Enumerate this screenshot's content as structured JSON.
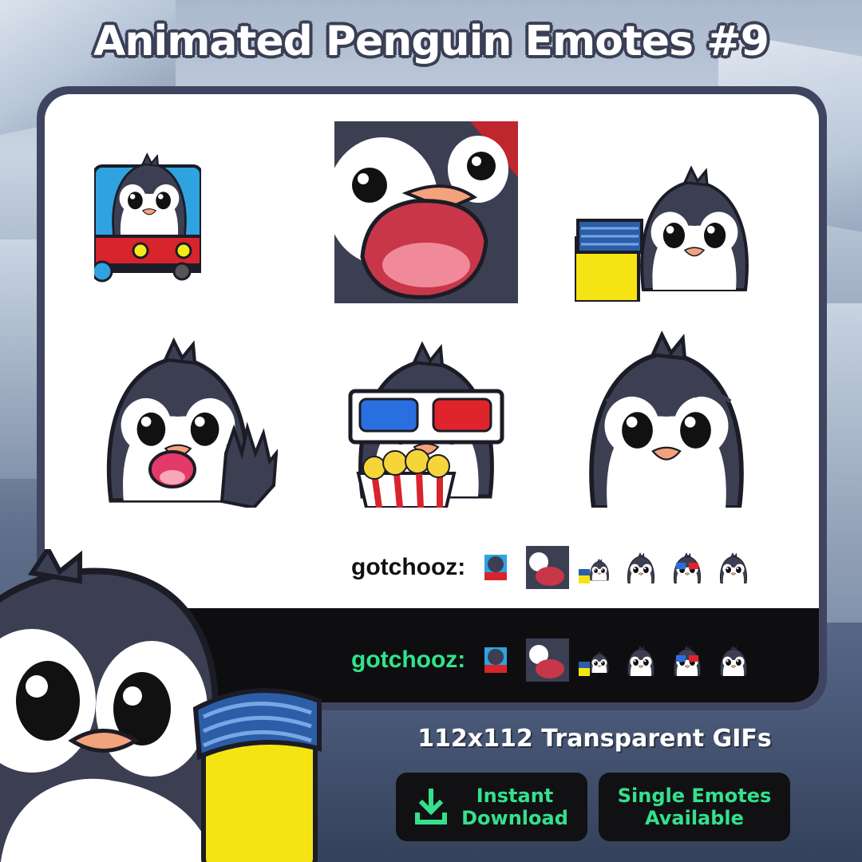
{
  "title": "Animated Penguin Emotes #9",
  "username_label": "gotchooz:",
  "emotes": [
    "train-penguin",
    "shouting-penguin",
    "hype-penguin",
    "waving-penguin",
    "popcorn-3d-glasses-penguin",
    "cute-penguin"
  ],
  "format_text": "112x112 Transparent GIFs",
  "buttons": {
    "instant_line1": "Instant",
    "instant_line2": "Download",
    "single_line1": "Single Emotes",
    "single_line2": "Available"
  },
  "colors": {
    "panel_border": "#3f4561",
    "dark_strip": "#0e0e10",
    "accent_green": "#35e08c",
    "username_dark": "#2fe58a",
    "penguin_body": "#3c3f52",
    "beak": "#f4a27b"
  }
}
